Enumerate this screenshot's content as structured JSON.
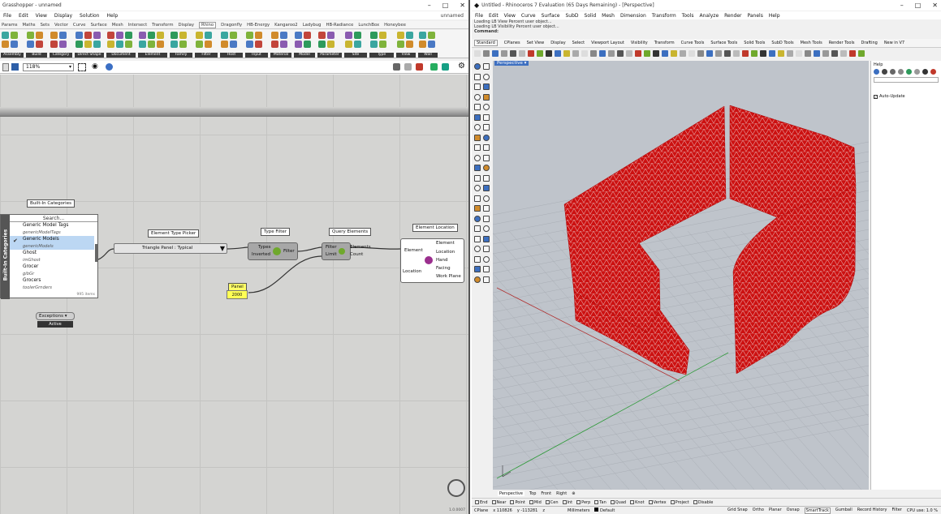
{
  "grasshopper": {
    "title": "Grasshopper - unnamed",
    "doc_name": "unnamed",
    "menu": [
      "File",
      "Edit",
      "View",
      "Display",
      "Solution",
      "Help"
    ],
    "tabs": [
      "Params",
      "Maths",
      "Sets",
      "Vector",
      "Curve",
      "Surface",
      "Mesh",
      "Intersect",
      "Transform",
      "Display",
      "Rhino",
      "Dragonfly",
      "HB-Energy",
      "Kangaroo2",
      "Ladybug",
      "HB-Radiance",
      "LunchBox",
      "Honeybee"
    ],
    "active_tab": "Rhino",
    "ribbon_groups": [
      "Assembly",
      "Build",
      "Category",
      "Direct Shape",
      "Document",
      "Element",
      "Family",
      "Filter",
      "Host",
      "Input",
      "Material",
      "Model",
      "Parameter",
      "Site",
      "Type",
      "View",
      "Wall"
    ],
    "zoom": "118%",
    "nodes": {
      "built_in_categories": {
        "caption": "Built-In Categories",
        "side_label": "Built-In Categories",
        "search": "Search...",
        "items": [
          "Generic Model Tags",
          "genericModelTags",
          "Generic Models",
          "genericModels",
          "Ghost",
          "imGhost",
          "Grocer",
          "gibGr",
          "Grocers",
          "toolerGrnders"
        ],
        "selected": "Generic Models",
        "footer": "995 items"
      },
      "element_type_picker": {
        "caption": "Element Type Picker",
        "value": "Triangle Panel : Typical"
      },
      "type_filter": {
        "caption": "Type Filter",
        "in": [
          "Types",
          "Inverted"
        ],
        "out": "Filter"
      },
      "query_elements": {
        "caption": "Query Elements",
        "in": [
          "Filter",
          "Limit"
        ],
        "out": [
          "Elements",
          "Count"
        ]
      },
      "element_location": {
        "caption": "Element Location",
        "in": [
          "Element",
          "Location"
        ],
        "out": [
          "Element",
          "Location",
          "Hand",
          "Facing",
          "Work Plane"
        ]
      },
      "panel": {
        "caption": "Panel",
        "value": "2000"
      },
      "exceptions": {
        "label": "Exceptions",
        "status": "Active"
      }
    },
    "footer_version": "1.0.0007"
  },
  "rhino": {
    "title": "Untitled - Rhinoceros 7 Evaluation (65 Days Remaining) - [Perspective]",
    "menu": [
      "File",
      "Edit",
      "View",
      "Curve",
      "Surface",
      "SubD",
      "Solid",
      "Mesh",
      "Dimension",
      "Transform",
      "Tools",
      "Analyze",
      "Render",
      "Panels",
      "Help"
    ],
    "command_history": [
      "Loading LB View Percent user object...",
      "Loading LB Visibility Percent user object..."
    ],
    "command_prompt": "Command:",
    "toolbar_tabs": [
      "Standard",
      "CPlanes",
      "Set View",
      "Display",
      "Select",
      "Viewport Layout",
      "Visibility",
      "Transform",
      "Curve Tools",
      "Surface Tools",
      "Solid Tools",
      "SubD Tools",
      "Mesh Tools",
      "Render Tools",
      "Drafting",
      "New in V7"
    ],
    "viewport_label": "Perspective",
    "view_tabs": [
      "Perspective",
      "Top",
      "Front",
      "Right"
    ],
    "osnaps": [
      "End",
      "Near",
      "Point",
      "Mid",
      "Cen",
      "Int",
      "Perp",
      "Tan",
      "Quad",
      "Knot",
      "Vertex",
      "Project",
      "Disable"
    ],
    "side_panel": {
      "title": "Help",
      "auto_update": "Auto-Update"
    },
    "status": {
      "cplane": "CPlane",
      "x": "x 110826",
      "y": "y -113281",
      "z": "z",
      "units": "Millimeters",
      "layer": "Default",
      "items": [
        "Grid Snap",
        "Ortho",
        "Planar",
        "Osnap",
        "SmartTrack",
        "Gumball",
        "Record History",
        "Filter"
      ],
      "cpu": "CPU use: 1.0 %"
    },
    "colors": {
      "mesh": "#cc1111",
      "viewport_bg": "#bfc4cb",
      "x_axis": "#b03030",
      "y_axis": "#2f9a3a"
    }
  }
}
